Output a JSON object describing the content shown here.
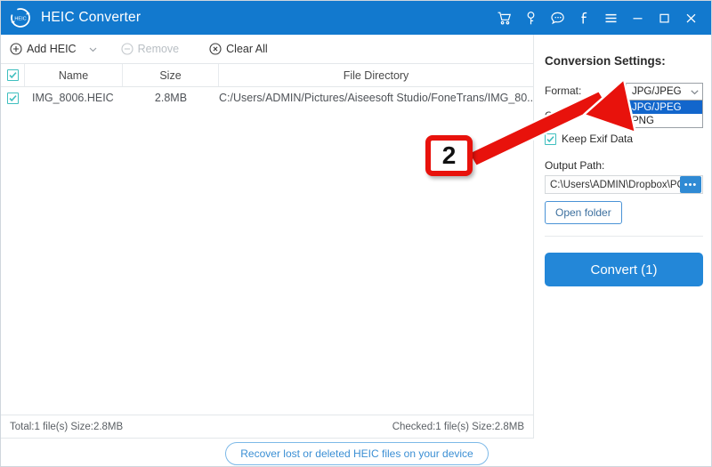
{
  "titlebar": {
    "app_title": "HEIC Converter",
    "logo_text": "HEIC",
    "icons": [
      {
        "name": "cart-icon",
        "glyph": "cart"
      },
      {
        "name": "key-icon",
        "glyph": "key"
      },
      {
        "name": "chat-icon",
        "glyph": "chat"
      },
      {
        "name": "facebook-icon",
        "glyph": "f"
      },
      {
        "name": "menu-icon",
        "glyph": "hamburger"
      },
      {
        "name": "minimize-icon",
        "glyph": "minimize"
      },
      {
        "name": "maximize-icon",
        "glyph": "maximize"
      },
      {
        "name": "close-icon",
        "glyph": "close"
      }
    ]
  },
  "toolbar": {
    "add_label": "Add HEIC",
    "remove_label": "Remove",
    "clear_label": "Clear All"
  },
  "table": {
    "headers": {
      "name": "Name",
      "size": "Size",
      "directory": "File Directory"
    },
    "rows": [
      {
        "checked": true,
        "name": "IMG_8006.HEIC",
        "size": "2.8MB",
        "directory": "C:/Users/ADMIN/Pictures/Aiseesoft Studio/FoneTrans/IMG_80..."
      }
    ]
  },
  "status": {
    "left": "Total:1 file(s) Size:2.8MB",
    "right": "Checked:1 file(s) Size:2.8MB"
  },
  "bottom": {
    "recover_label": "Recover lost or deleted HEIC files on your device"
  },
  "settings": {
    "title": "Conversion Settings:",
    "format_label": "Format:",
    "format_value": "JPG/JPEG",
    "quality_label": "Q",
    "format_options": [
      {
        "label": "JPG/JPEG",
        "selected": true
      },
      {
        "label": "PNG",
        "selected": false
      }
    ],
    "exif_label": "Keep Exif Data",
    "exif_checked": true,
    "output_label": "Output Path:",
    "output_path": "C:\\Users\\ADMIN\\Dropbox\\PC\\",
    "browse_label": "•••",
    "open_folder_label": "Open folder",
    "convert_label": "Convert (1)"
  },
  "annotation": {
    "badge_label": "2",
    "badge_color": "#e8120c",
    "arrow_color": "#e8120c"
  },
  "colors": {
    "titlebar_blue": "#1279ce",
    "accent_blue": "#2387d8",
    "dropdown_highlight": "#1266cc",
    "checkbox_teal": "#3fbfbf"
  }
}
